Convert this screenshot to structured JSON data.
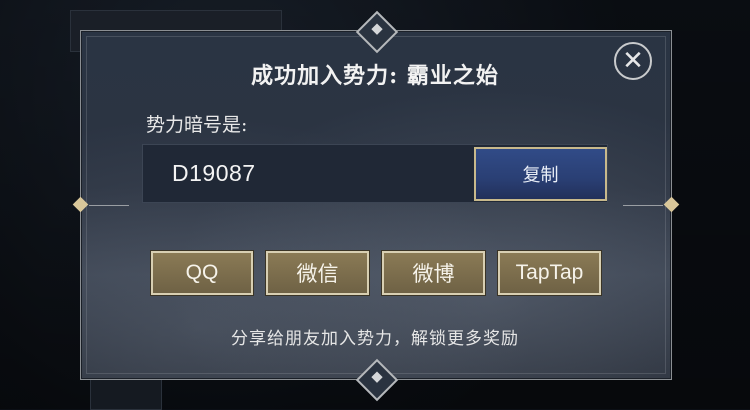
{
  "dialog": {
    "title": "成功加入势力: 霸业之始",
    "code_label": "势力暗号是:",
    "code_value": "D19087",
    "copy_label": "复制",
    "share_buttons": [
      "QQ",
      "微信",
      "微博",
      "TapTap"
    ],
    "hint": "分享给朋友加入势力，解锁更多奖励",
    "close_icon": "close-icon",
    "close_glyph": "✕"
  },
  "colors": {
    "copy_button": "#2f4a86",
    "share_button": "#7c6d4d",
    "dialog_bg": "#2c3442"
  }
}
